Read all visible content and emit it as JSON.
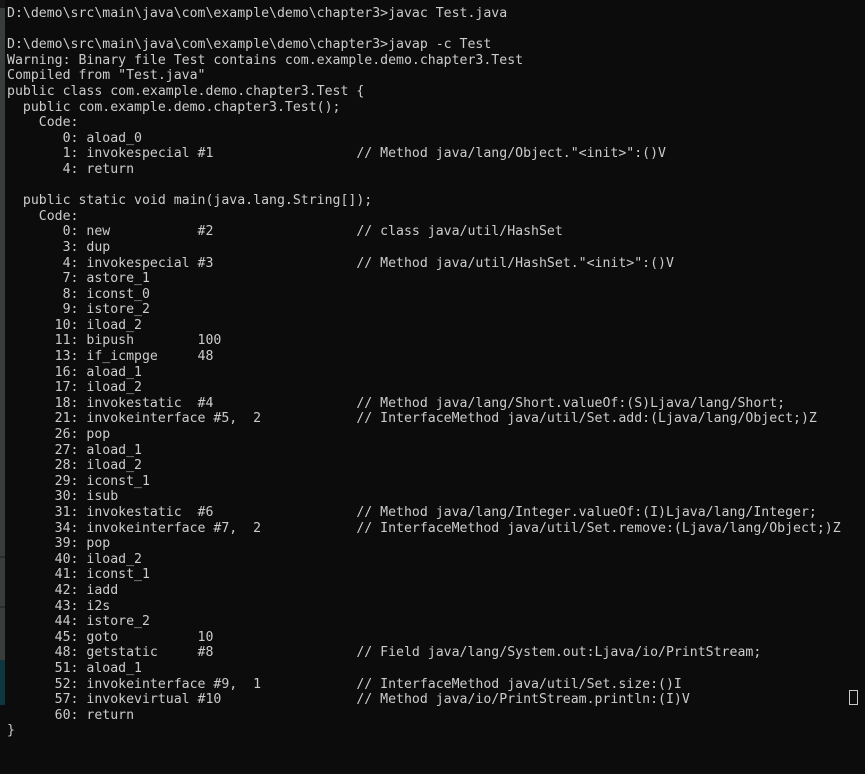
{
  "window": {
    "title": "Command Prompt - javap -c Test",
    "background_color": "#0c0c0c",
    "text_color": "#cccccc",
    "gutter_color": "#3a3d3d",
    "gutter_highlight_color": "#0d3640"
  },
  "terminal": {
    "prompt_path": "D:\\demo\\src\\main\\java\\com\\example\\demo\\chapter3>",
    "commands": [
      "javac Test.java",
      "javap -c Test"
    ],
    "comment_column": 44,
    "lines": [
      "D:\\demo\\src\\main\\java\\com\\example\\demo\\chapter3>javac Test.java",
      "",
      "D:\\demo\\src\\main\\java\\com\\example\\demo\\chapter3>javap -c Test",
      "Warning: Binary file Test contains com.example.demo.chapter3.Test",
      "Compiled from \"Test.java\"",
      "public class com.example.demo.chapter3.Test {",
      "  public com.example.demo.chapter3.Test();",
      "    Code:",
      "       0: aload_0",
      "       1: invokespecial #1                  // Method java/lang/Object.\"<init>\":()V",
      "       4: return",
      "",
      "  public static void main(java.lang.String[]);",
      "    Code:",
      "       0: new           #2                  // class java/util/HashSet",
      "       3: dup",
      "       4: invokespecial #3                  // Method java/util/HashSet.\"<init>\":()V",
      "       7: astore_1",
      "       8: iconst_0",
      "       9: istore_2",
      "      10: iload_2",
      "      11: bipush        100",
      "      13: if_icmpge     48",
      "      16: aload_1",
      "      17: iload_2",
      "      18: invokestatic  #4                  // Method java/lang/Short.valueOf:(S)Ljava/lang/Short;",
      "      21: invokeinterface #5,  2            // InterfaceMethod java/util/Set.add:(Ljava/lang/Object;)Z",
      "      26: pop",
      "      27: aload_1",
      "      28: iload_2",
      "      29: iconst_1",
      "      30: isub",
      "      31: invokestatic  #6                  // Method java/lang/Integer.valueOf:(I)Ljava/lang/Integer;",
      "      34: invokeinterface #7,  2            // InterfaceMethod java/util/Set.remove:(Ljava/lang/Object;)Z",
      "      39: pop",
      "      40: iload_2",
      "      41: iconst_1",
      "      42: iadd",
      "      43: i2s",
      "      44: istore_2",
      "      45: goto          10",
      "      48: getstatic     #8                  // Field java/lang/System.out:Ljava/io/PrintStream;",
      "      51: aload_1",
      "      52: invokeinterface #9,  1            // InterfaceMethod java/util/Set.size:()I",
      "      57: invokevirtual #10                 // Method java/io/PrintStream.println:(I)V",
      "      60: return",
      "}"
    ]
  }
}
